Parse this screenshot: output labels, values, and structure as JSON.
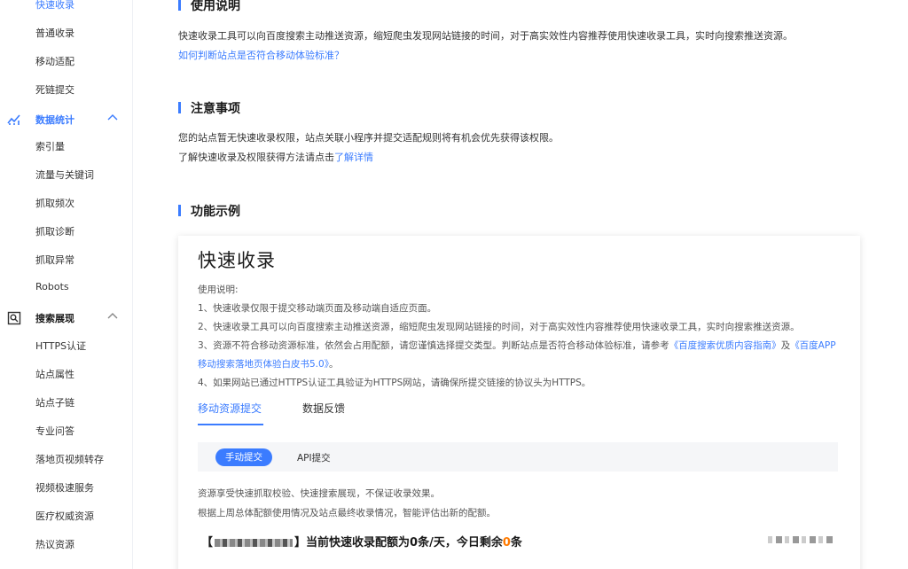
{
  "sidebar": {
    "items_top": [
      "快速收录",
      "普通收录",
      "移动适配",
      "死链提交"
    ],
    "groups": [
      {
        "label": "数据统计",
        "icon": "chart-icon",
        "items": [
          "索引量",
          "流量与关键词",
          "抓取频次",
          "抓取诊断",
          "抓取异常",
          "Robots"
        ]
      },
      {
        "label": "搜索展现",
        "icon": "search-display-icon",
        "items": [
          "HTTPS认证",
          "站点属性",
          "站点子链",
          "专业问答",
          "落地页视频转存",
          "视频极速服务",
          "医疗权威资源",
          "热议资源"
        ]
      }
    ]
  },
  "main": {
    "usage": {
      "title": "使用说明",
      "text": "快速收录工具可以向百度搜索主动推送资源，缩短爬虫发现网站链接的时间，对于高实效性内容推荐使用快速收录工具，实时向搜索推送资源。",
      "link": "如何判断站点是否符合移动体验标准？"
    },
    "notice": {
      "title": "注意事项",
      "text1": "您的站点暂无快速收录权限，站点关联小程序并提交适配规则将有机会优先获得该权限。",
      "text2_prefix": "了解快速收录及权限获得方法请点击",
      "text2_link": "了解详情"
    },
    "example": {
      "title": "功能示例",
      "card_title": "快速收录",
      "heading": "使用说明:",
      "line1": "1、快速收录仅限于提交移动端页面及移动端自适应页面。",
      "line2": "2、快速收录工具可以向百度搜索主动推送资源，缩短爬虫发现网站链接的时间，对于高实效性内容推荐使用快速收录工具，实时向搜索推送资源。",
      "line3_prefix": "3、资源不符合移动资源标准，依然会占用配额，请您谨慎选择提交类型。判断站点是否符合移动体验标准，请参考",
      "line3_link1": "《百度搜索优质内容指南》",
      "line3_mid": "及",
      "line3_link2a": "《百度APP",
      "line3_link2b": "移动搜索落地页体验白皮书5.0》",
      "line3_end": "。",
      "line4": "4、如果网站已通过HTTPS认证工具验证为HTTPS网站，请确保所提交链接的协议头为HTTPS。",
      "tabs": [
        "移动资源提交",
        "数据反馈"
      ],
      "subtabs": [
        "手动提交",
        "API提交"
      ],
      "desc1": "资源享受快速抓取校验、快速搜索展现，不保证收录效果。",
      "desc2": "根据上周总体配额使用情况及站点最终收录情况，智能评估出新的配额。",
      "quota_open": "【",
      "quota_close": "】当前快速收录配额为",
      "quota_value": "0",
      "quota_mid": "条/天，今日剩余",
      "quota_remain": "0",
      "quota_unit": "条"
    }
  },
  "colors": {
    "accent": "#3b7cff",
    "warning": "#ff7a00"
  }
}
